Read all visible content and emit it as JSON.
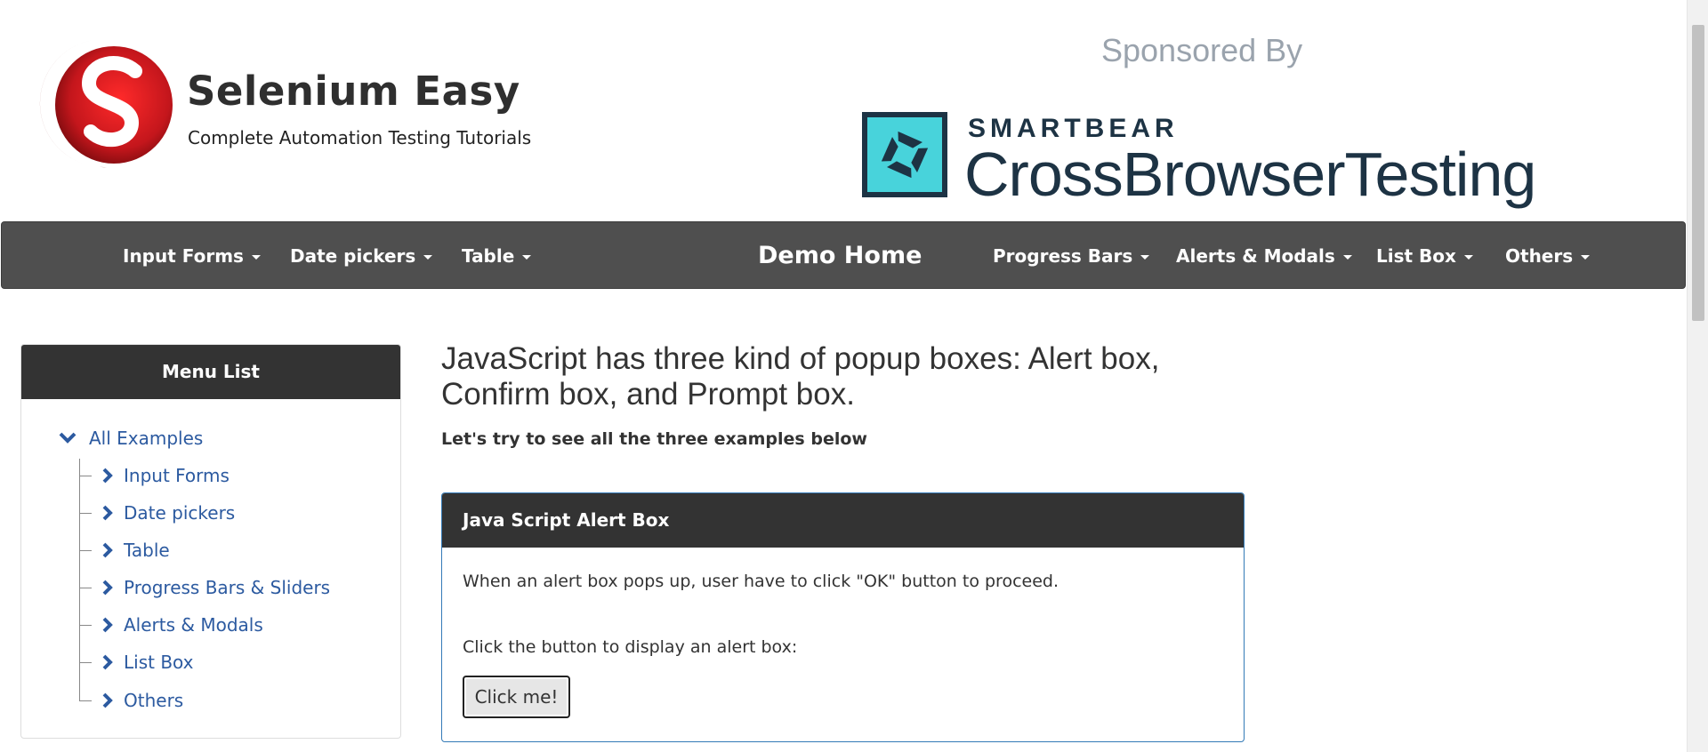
{
  "header": {
    "brand_title": "Selenium Easy",
    "brand_subtitle": "Complete Automation Testing Tutorials",
    "logo_icon": "selenium-easy-logo-icon",
    "sponsor_label": "Sponsored By",
    "sponsor_brand": "SMARTBEAR",
    "sponsor_product": "CrossBrowserTesting",
    "sponsor_icon": "crossbrowsertesting-logo-icon"
  },
  "navbar": {
    "items": [
      {
        "label": "Input Forms",
        "has_dropdown": true
      },
      {
        "label": "Date pickers",
        "has_dropdown": true
      },
      {
        "label": "Table",
        "has_dropdown": true
      },
      {
        "label": "Demo Home",
        "has_dropdown": false
      },
      {
        "label": "Progress Bars",
        "has_dropdown": true
      },
      {
        "label": "Alerts & Modals",
        "has_dropdown": true
      },
      {
        "label": "List Box",
        "has_dropdown": true
      },
      {
        "label": "Others",
        "has_dropdown": true
      }
    ]
  },
  "sidebar": {
    "title": "Menu List",
    "root": "All Examples",
    "items": [
      {
        "label": "Input Forms"
      },
      {
        "label": "Date pickers"
      },
      {
        "label": "Table"
      },
      {
        "label": "Progress Bars & Sliders"
      },
      {
        "label": "Alerts & Modals"
      },
      {
        "label": "List Box"
      },
      {
        "label": "Others"
      }
    ]
  },
  "main": {
    "heading": "JavaScript has three kind of popup boxes: Alert box, Confirm box, and Prompt box.",
    "intro": "Let's try to see all the three examples below",
    "alert_panel": {
      "title": "Java Script Alert Box",
      "description": "When an alert box pops up, user have to click \"OK\" button to proceed.",
      "prompt": "Click the button to display an alert box:",
      "button_label": "Click me!"
    }
  },
  "colors": {
    "navbar_bg": "#4f4f4f",
    "panel_head_bg": "#333333",
    "link_blue": "#2c5aa0",
    "panel_border": "#337ab7",
    "sponsor_teal": "#48d3db",
    "sponsor_navy": "#1d3344",
    "logo_red": "#c4161c"
  }
}
